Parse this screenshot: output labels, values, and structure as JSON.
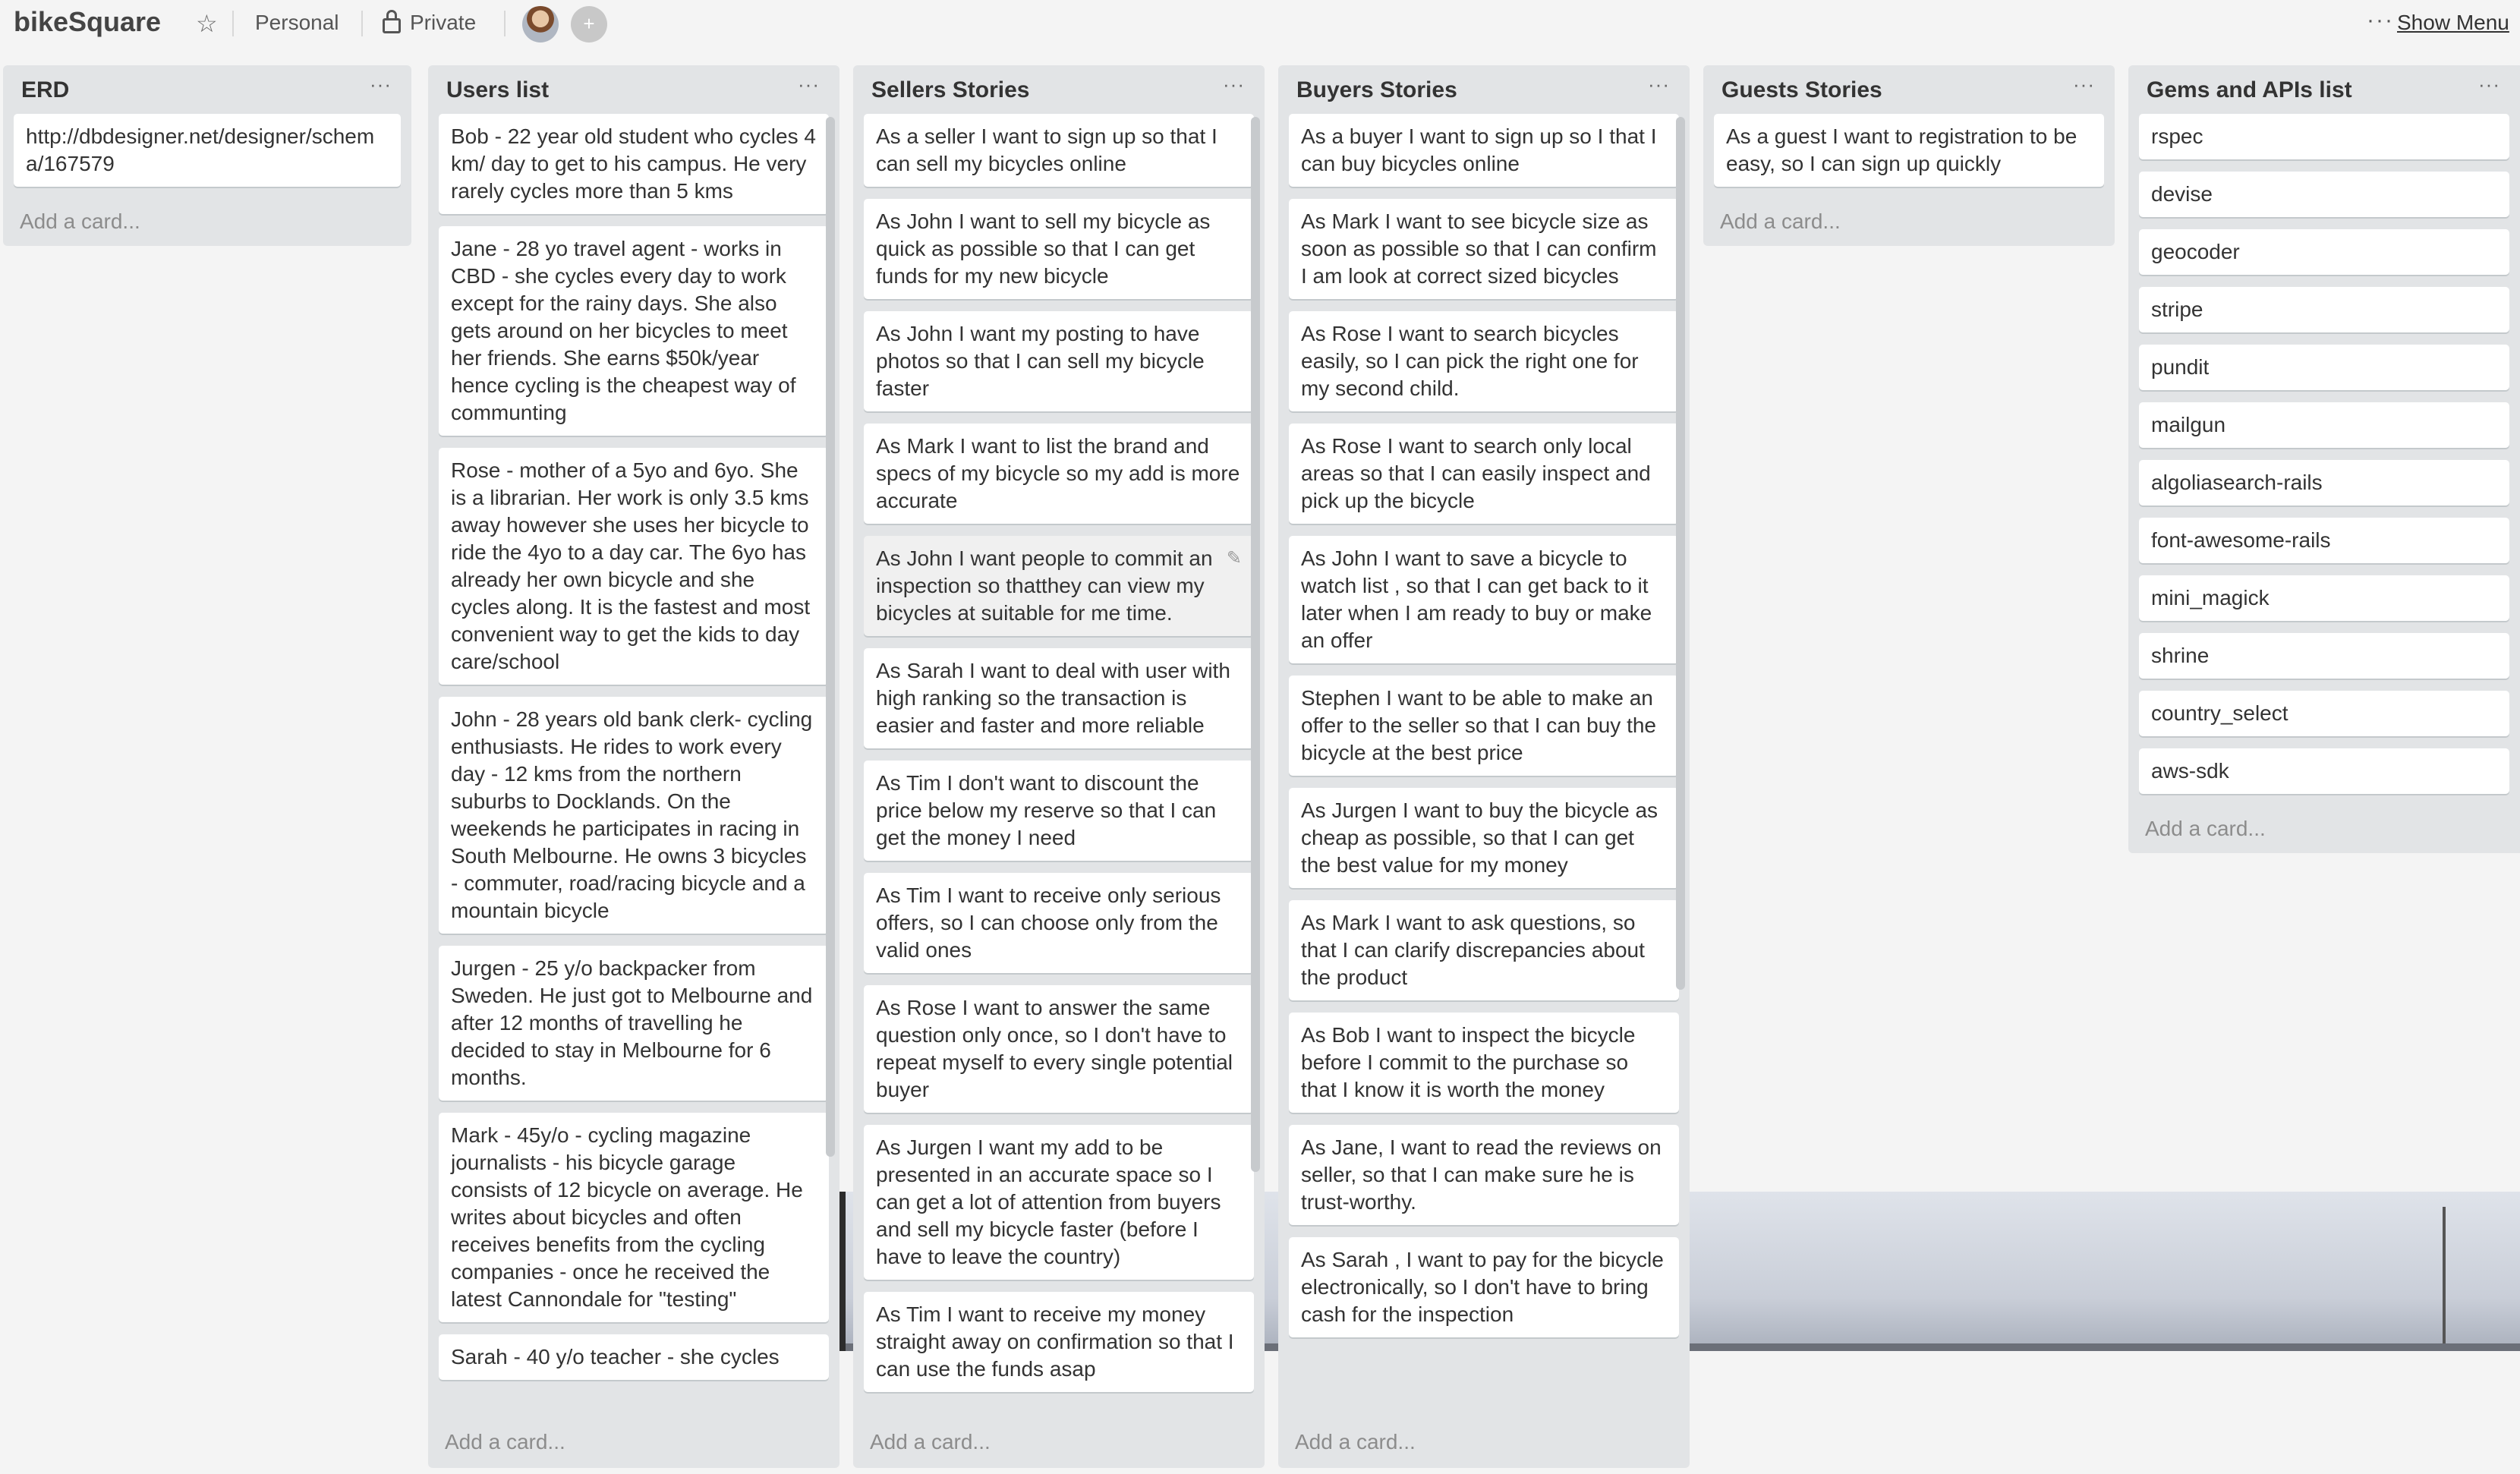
{
  "header": {
    "board_title": "bikeSquare",
    "team": "Personal",
    "visibility": "Private",
    "menu_label": "Show Menu"
  },
  "lists": {
    "erd": {
      "title": "ERD",
      "cards": [
        "http://dbdesigner.net/designer/schema/167579"
      ],
      "add": "Add a card..."
    },
    "users": {
      "title": "Users list",
      "cards": [
        "Bob - 22 year old student who cycles 4 km/ day to get to his campus. He very rarely cycles more than 5 kms",
        "Jane - 28 yo travel agent - works in CBD - she cycles every day to work except for the rainy days. She also gets around on her bicycles to meet her friends. She earns $50k/year hence cycling is the cheapest way of communting",
        "Rose - mother of a 5yo and 6yo. She is a librarian. Her work is only 3.5 kms away however she uses her bicycle to ride the 4yo to a day car. The 6yo has already her own bicycle and she cycles along. It is the fastest and most convenient way to get the kids to day care/school",
        "John - 28 years old bank clerk- cycling enthusiasts. He rides to work every day - 12 kms from the northern suburbs to Docklands. On the weekends he participates in racing in South Melbourne. He owns 3 bicycles - commuter, road/racing bicycle and a mountain bicycle",
        "Jurgen - 25 y/o backpacker from Sweden. He just got to Melbourne and after 12 months of travelling he decided to stay in Melbourne for 6 months.",
        "Mark - 45y/o - cycling magazine journalists - his bicycle garage consists of 12 bicycle on average. He writes about bicycles and often receives benefits from the cycling companies - once he received the latest Cannondale for \"testing\"",
        "Sarah - 40 y/o teacher - she cycles"
      ],
      "add": "Add a card..."
    },
    "sellers": {
      "title": "Sellers Stories",
      "cards": [
        "As a seller I want to sign up so that I can sell my bicycles online",
        "As John I want to sell my bicycle as quick as possible so that I can get funds for my new bicycle",
        "As John I want my posting to have photos so that I can sell my bicycle faster",
        "As Mark I want to list the brand and specs of my bicycle so my add is more accurate",
        "As John I want people to commit an inspection so thatthey can view my bicycles at suitable for me time.",
        "As Sarah I want to deal with user with high ranking so the transaction is easier and faster and more reliable",
        "As Tim I don't want to discount the price below my reserve so that I can get the money I need",
        "As Tim I want to receive only serious offers, so I can choose only from the valid ones",
        "As Rose I want to answer the same question only once, so I don't have to repeat myself to every single potential buyer",
        "As Jurgen I want my add to be presented in an accurate space so I can get a lot of attention from buyers and sell my bicycle faster (before I have to leave the country)",
        "As Tim I want to receive my money straight away on confirmation so that I can use the funds asap"
      ],
      "add": "Add a card..."
    },
    "buyers": {
      "title": "Buyers Stories",
      "cards": [
        "As a buyer I want to sign up so I that I can buy bicycles online",
        "As Mark I want to see bicycle size as soon as possible so that I can confirm I am look at correct sized bicycles",
        "As Rose I want to search bicycles easily, so I can pick the right one for my second child.",
        "As Rose I want to search only local areas so that I can easily inspect and pick up the bicycle",
        "As John I want to save a bicycle to watch list , so that I can get back to it later when I am ready to buy or make an offer",
        "Stephen I want to be able to make an offer to the seller so that I can buy the bicycle at the best price",
        "As Jurgen I want to buy the bicycle as cheap as possible, so that I can get the best value for my money",
        "As Mark I want to ask questions, so that I can clarify discrepancies about the product",
        "As Bob I want to inspect the bicycle before I commit to the purchase so that I know it is worth the money",
        "As Jane, I want to read the reviews on seller, so that I can make sure he is trust-worthy.",
        "As Sarah , I want to pay for the bicycle electronically, so I don't have to bring cash for the inspection"
      ],
      "add": "Add a card..."
    },
    "guests": {
      "title": "Guests Stories",
      "cards": [
        "As a guest I want to registration to be easy, so I can sign up quickly"
      ],
      "add": "Add a card..."
    },
    "gems": {
      "title": "Gems and APIs list",
      "cards": [
        "rspec",
        "devise",
        "geocoder",
        "stripe",
        "pundit",
        "mailgun",
        "algoliasearch-rails",
        "font-awesome-rails",
        "mini_magick",
        "shrine",
        "country_select",
        "aws-sdk"
      ],
      "add": "Add a card..."
    }
  }
}
